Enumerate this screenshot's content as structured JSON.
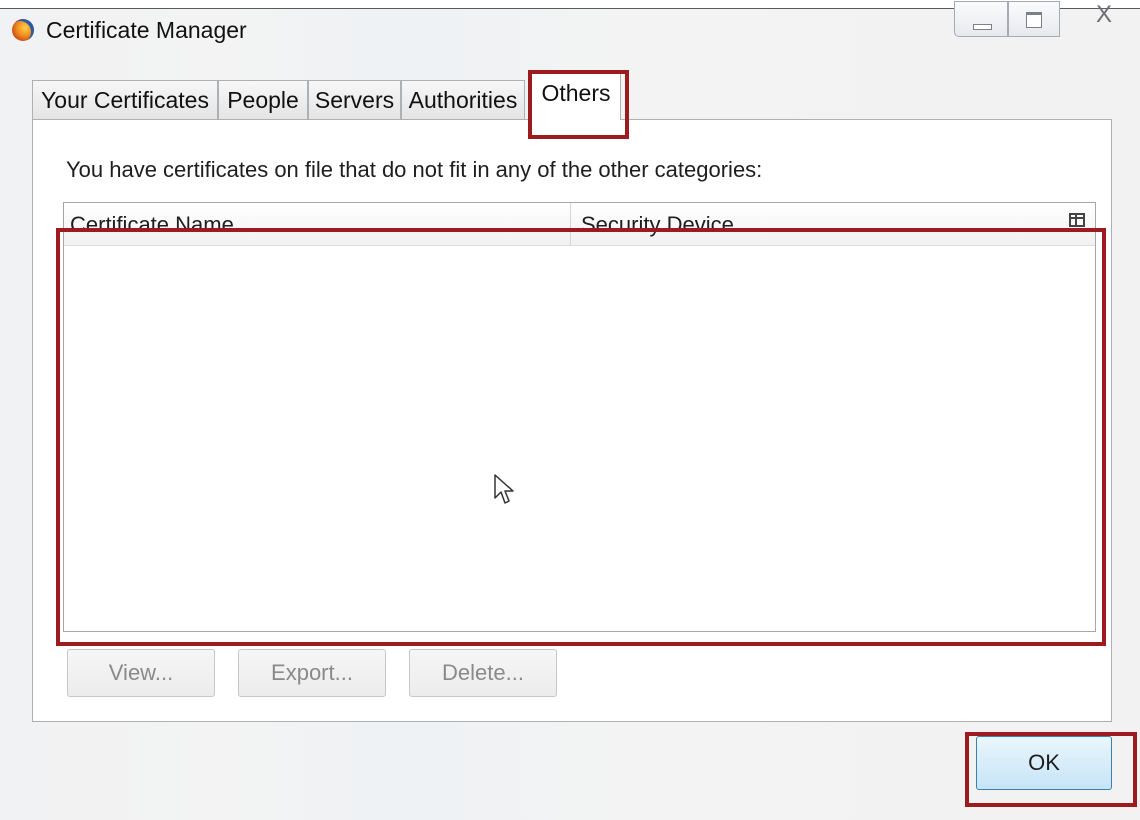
{
  "window": {
    "title": "Certificate Manager",
    "icon": "firefox-icon",
    "controls": {
      "minimize": "minimize-icon",
      "maximize": "maximize-icon",
      "close": "X"
    }
  },
  "tabs": [
    {
      "label": "Your Certificates",
      "active": false
    },
    {
      "label": "People",
      "active": false
    },
    {
      "label": "Servers",
      "active": false
    },
    {
      "label": "Authorities",
      "active": false
    },
    {
      "label": "Others",
      "active": true
    }
  ],
  "panel": {
    "description": "You have certificates on file that do not fit in any of the other categories:",
    "columns": [
      "Certificate Name",
      "Security Device"
    ],
    "rows": []
  },
  "actions": {
    "view": "View...",
    "export": "Export...",
    "delete": "Delete..."
  },
  "footer": {
    "ok": "OK"
  },
  "colors": {
    "highlight": "#9b1b1f",
    "ok_button_border": "#3c7fb1"
  }
}
